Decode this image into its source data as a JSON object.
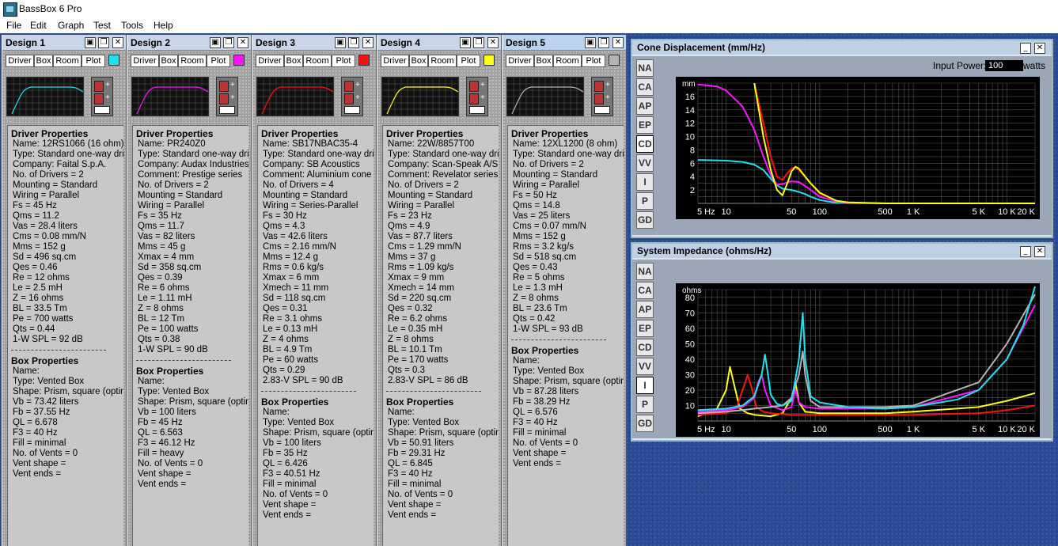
{
  "app": {
    "title": "BassBox 6 Pro"
  },
  "menu": [
    "File",
    "Edit",
    "Graph",
    "Test",
    "Tools",
    "Help"
  ],
  "common": {
    "tabs": [
      "Driver",
      "Box",
      "Room",
      "Plot"
    ],
    "save_icon": "save-icon",
    "copy_icon": "copy-icon",
    "close_symbol": "✕"
  },
  "designs": [
    {
      "title": "Design 1",
      "color": "#19e4f0",
      "driver": [
        "Name: 12RS1066 (16 ohm)",
        "Type: Standard one-way driver",
        "Company: Faital S.p.A.",
        "No. of Drivers = 2",
        "Mounting = Standard",
        "Wiring = Parallel",
        "Fs =  45 Hz",
        "Qms =  11.2",
        "Vas =  28.4 liters",
        "Cms =  0.08 mm/N",
        "Mms =  152 g",
        "Sd =  496 sq.cm",
        "Qes =  0.46",
        "Re =  12 ohms",
        "Le =  2.5 mH",
        "Z =  16 ohms",
        "BL =  33.5 Tm",
        "Pe =  700 watts",
        "Qts =  0.44",
        "1-W SPL =  92 dB"
      ],
      "box": [
        "Name:",
        "Type: Vented Box",
        "Shape: Prism, square (optimum)",
        "Vb =  73.42 liters",
        "Fb =  37.55 Hz",
        "QL =  6.678",
        "F3 =  40 Hz",
        "Fill = minimal",
        "No. of Vents = 0",
        "  Vent shape =",
        "  Vent ends ="
      ]
    },
    {
      "title": "Design 2",
      "color": "#ff14ff",
      "driver": [
        "Name: PR240Z0",
        "Type: Standard one-way driver",
        "Company: Audax Industries",
        "Comment: Prestige series",
        "No. of Drivers = 2",
        "Mounting = Standard",
        "Wiring = Parallel",
        "Fs =  35 Hz",
        "Qms =  11.7",
        "Vas =  82 liters",
        "Mms =  45 g",
        "Xmax =  4 mm",
        "Sd =  358 sq.cm",
        "Qes =  0.39",
        "Re =  6 ohms",
        "Le =  1.11 mH",
        "Z =  8 ohms",
        "BL =  12 Tm",
        "Pe =  100 watts",
        "Qts =  0.38",
        "1-W SPL =  90 dB"
      ],
      "box": [
        "Name:",
        "Type: Vented Box",
        "Shape: Prism, square (optimum)",
        "Vb =  100 liters",
        "Fb =  45 Hz",
        "QL =  6.563",
        "F3 =  46.12 Hz",
        "Fill = heavy",
        "No. of Vents = 0",
        "  Vent shape =",
        "  Vent ends ="
      ]
    },
    {
      "title": "Design 3",
      "color": "#ff1010",
      "driver": [
        "Name: SB17NBAC35-4",
        "Type: Standard one-way driver",
        "Company: SB Acoustics",
        "Comment: Aluminium cone",
        "No. of Drivers = 4",
        "Mounting = Standard",
        "Wiring = Series-Parallel",
        "Fs =  30 Hz",
        "Qms =  4.3",
        "Vas =  42.6 liters",
        "Cms =  2.16 mm/N",
        "Mms =  12.4 g",
        "Rms =  0.6 kg/s",
        "Xmax =  6 mm",
        "Xmech =  11 mm",
        "Sd =  118 sq.cm",
        "Qes =  0.31",
        "Re =  3.1 ohms",
        "Le =  0.13 mH",
        "Z =  4 ohms",
        "BL =  4.9 Tm",
        "Pe =  60 watts",
        "Qts =  0.29",
        "2.83-V SPL =  90 dB"
      ],
      "box": [
        "Name:",
        "Type: Vented Box",
        "Shape: Prism, square (optimum)",
        "Vb =  100 liters",
        "Fb =  35 Hz",
        "QL =  6.426",
        "F3 =  40.51 Hz",
        "Fill = minimal",
        "No. of Vents = 0",
        "  Vent shape =",
        "  Vent ends ="
      ]
    },
    {
      "title": "Design 4",
      "color": "#ffff10",
      "driver": [
        "Name: 22W/8857T00",
        "Type: Standard one-way driver",
        "Company: Scan-Speak A/S",
        "Comment: Revelator series",
        "No. of Drivers = 2",
        "Mounting = Standard",
        "Wiring = Parallel",
        "Fs =  23 Hz",
        "Qms =  4.9",
        "Vas =  87.7 liters",
        "Cms =  1.29 mm/N",
        "Mms =  37 g",
        "Rms =  1.09 kg/s",
        "Xmax =  9 mm",
        "Xmech =  14 mm",
        "Sd =  220 sq.cm",
        "Qes =  0.32",
        "Re =  6.2 ohms",
        "Le =  0.35 mH",
        "Z =  8 ohms",
        "BL =  10.1 Tm",
        "Pe =  170 watts",
        "Qts =  0.3",
        "2.83-V SPL =  86 dB"
      ],
      "box": [
        "Name:",
        "Type: Vented Box",
        "Shape: Prism, square (optimum)",
        "Vb =  50.91 liters",
        "Fb =  29.31 Hz",
        "QL =  6.845",
        "F3 =  40 Hz",
        "Fill = minimal",
        "No. of Vents = 0",
        "  Vent shape =",
        "  Vent ends ="
      ]
    },
    {
      "title": "Design 5",
      "color": "#b4b4b4",
      "driver": [
        "Name: 12XL1200 (8 ohm)",
        "Type: Standard one-way driver",
        "No. of Drivers = 2",
        "Mounting = Standard",
        "Wiring = Parallel",
        "Fs =  50 Hz",
        "Qms =  14.8",
        "Vas =  25 liters",
        "Cms =  0.07 mm/N",
        "Mms =  152 g",
        "Rms =  3.2 kg/s",
        "Sd =  518 sq.cm",
        "Qes =  0.43",
        "Re =  5 ohms",
        "Le =  1.3 mH",
        "Z =  8 ohms",
        "BL =  23.6 Tm",
        "Qts =  0.42",
        "1-W SPL =  93 dB"
      ],
      "box": [
        "Name:",
        "Type: Vented Box",
        "Shape: Prism, square (optimum)",
        "Vb =  87.28 liters",
        "Fb =  38.29 Hz",
        "QL =  6.576",
        "F3 =  40 Hz",
        "Fill = minimal",
        "No. of Vents = 0",
        "  Vent shape =",
        "  Vent ends ="
      ]
    }
  ],
  "labels": {
    "driver_properties": "Driver Properties",
    "box_properties": "Box Properties"
  },
  "graph_buttons": [
    "NA",
    "CA",
    "AP",
    "EP",
    "CD",
    "VV",
    "I",
    "P",
    "GD"
  ],
  "input_power": {
    "label": "Input Power:",
    "value": "100",
    "unit": "watts"
  },
  "chart_data": [
    {
      "type": "line",
      "title": "Cone Displacement (mm/Hz)",
      "ylabel": "mm",
      "xlabel": "",
      "x_ticks": [
        "5 Hz",
        "10",
        "50",
        "100",
        "500",
        "1 K",
        "5 K",
        "10 K",
        "20 K"
      ],
      "y_ticks": [
        "2",
        "4",
        "6",
        "8",
        "10",
        "12",
        "14",
        "16"
      ],
      "xlim": [
        5,
        20000
      ],
      "ylim": [
        0,
        18
      ],
      "xscale": "log",
      "grid": true,
      "series": [
        {
          "color": "#19e4f0",
          "x": [
            5,
            10,
            15,
            20,
            25,
            30,
            35,
            40,
            50,
            60,
            70,
            80,
            100,
            150,
            200,
            500,
            1000,
            20000
          ],
          "y": [
            6.5,
            6.4,
            6.2,
            5.8,
            5.0,
            3.7,
            2.7,
            2.2,
            2.0,
            1.7,
            1.4,
            1.0,
            0.5,
            0.1,
            0.05,
            0,
            0,
            0
          ]
        },
        {
          "color": "#ff14ff",
          "x": [
            5,
            8,
            10,
            15,
            20,
            25,
            30,
            35,
            40,
            50,
            60,
            70,
            80,
            100,
            150,
            200,
            500,
            20000
          ],
          "y": [
            17.8,
            17.5,
            16.9,
            14.5,
            11.0,
            7.0,
            4.2,
            2.8,
            2.9,
            3.3,
            3.2,
            2.6,
            2.0,
            1.0,
            0.3,
            0.1,
            0,
            0
          ]
        },
        {
          "color": "#ff1010",
          "x": [
            20,
            25,
            30,
            35,
            40,
            45,
            50,
            55,
            60,
            70,
            80,
            100,
            150,
            200,
            500,
            20000
          ],
          "y": [
            18,
            12,
            7,
            4,
            3.5,
            4.5,
            5.2,
            5.4,
            5.0,
            4.0,
            3.0,
            1.5,
            0.4,
            0.15,
            0,
            0
          ]
        },
        {
          "color": "#ffff10",
          "x": [
            20,
            25,
            30,
            35,
            40,
            45,
            50,
            55,
            60,
            70,
            80,
            100,
            150,
            200,
            500,
            20000
          ],
          "y": [
            18,
            10,
            5,
            2,
            1.2,
            3.0,
            4.8,
            5.5,
            5.2,
            4.0,
            3.0,
            1.6,
            0.4,
            0.15,
            0,
            0
          ]
        }
      ]
    },
    {
      "type": "line",
      "title": "System Impedance (ohms/Hz)",
      "ylabel": "ohms",
      "xlabel": "",
      "x_ticks": [
        "5 Hz",
        "10",
        "50",
        "100",
        "500",
        "1 K",
        "5 K",
        "10 K",
        "20 K"
      ],
      "y_ticks": [
        "10",
        "20",
        "30",
        "40",
        "50",
        "60",
        "70",
        "80"
      ],
      "xlim": [
        5,
        20000
      ],
      "ylim": [
        0,
        85
      ],
      "xscale": "log",
      "grid": true,
      "series": [
        {
          "color": "#ffff10",
          "x": [
            5,
            8,
            10,
            11,
            12,
            14,
            17,
            20,
            30,
            40,
            50,
            55,
            60,
            70,
            100,
            500,
            1000,
            5000,
            10000,
            20000
          ],
          "y": [
            3,
            8,
            20,
            35,
            25,
            8,
            5,
            4,
            3,
            5,
            15,
            25,
            12,
            6,
            5,
            5,
            6,
            9,
            13,
            18
          ]
        },
        {
          "color": "#ff1010",
          "x": [
            5,
            10,
            13,
            15,
            17,
            19,
            21,
            25,
            30,
            50,
            100,
            500,
            1000,
            5000,
            10000,
            20000
          ],
          "y": [
            4,
            5,
            9,
            20,
            30,
            20,
            9,
            6,
            5,
            4,
            4,
            4,
            4,
            5,
            7,
            10
          ]
        },
        {
          "color": "#ff14ff",
          "x": [
            5,
            10,
            15,
            20,
            22,
            24,
            26,
            30,
            40,
            50,
            55,
            60,
            70,
            100,
            500,
            1000,
            5000,
            10000,
            20000
          ],
          "y": [
            6,
            7,
            9,
            15,
            25,
            30,
            20,
            10,
            7,
            9,
            20,
            12,
            9,
            8,
            8,
            9,
            20,
            40,
            75
          ]
        },
        {
          "color": "#b4b4b4",
          "x": [
            5,
            10,
            15,
            20,
            30,
            40,
            50,
            60,
            66,
            70,
            80,
            100,
            500,
            1000,
            5000,
            10000,
            20000
          ],
          "y": [
            5,
            6,
            7,
            8,
            9,
            10,
            15,
            30,
            45,
            30,
            13,
            9,
            9,
            10,
            25,
            50,
            82
          ]
        },
        {
          "color": "#19e4f0",
          "x": [
            5,
            10,
            15,
            20,
            24,
            26,
            28,
            30,
            35,
            40,
            50,
            60,
            66,
            70,
            80,
            100,
            200,
            500,
            1000,
            3000,
            5000,
            10000,
            15000,
            20000
          ],
          "y": [
            7,
            8,
            10,
            16,
            30,
            43,
            30,
            17,
            11,
            10,
            13,
            40,
            70,
            40,
            16,
            12,
            9,
            8,
            9,
            14,
            20,
            40,
            62,
            90
          ]
        }
      ]
    }
  ]
}
